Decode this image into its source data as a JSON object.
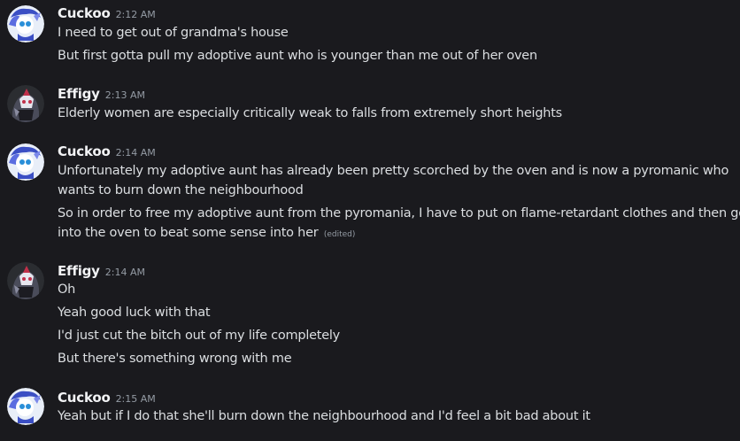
{
  "groups": [
    {
      "username": "Cuckoo",
      "time": "2:12 AM",
      "messages": [
        "I need to get out of grandma's house",
        "But first gotta pull my adoptive aunt who is younger than me out of her oven"
      ]
    },
    {
      "username": "Effigy",
      "time": "2:13 AM",
      "messages": [
        "Elderly women are especially critically weak to falls from extremely short heights"
      ]
    },
    {
      "username": "Cuckoo",
      "time": "2:14 AM",
      "messages": [
        "Unfortunately my adoptive aunt has already been pretty scorched by the oven and is now a pyromanic who",
        "wants to burn down the neighbourhood",
        "So in order to free my adoptive aunt from the pyromania, I have to put on flame-retardant clothes and then go",
        "into the oven to beat some sense into her"
      ],
      "edited_label": "(edited)"
    },
    {
      "username": "Effigy",
      "time": "2:14 AM",
      "messages": [
        "Oh",
        "Yeah good luck with that",
        "I'd just cut the bitch out of my life completely",
        "But there's something wrong with me"
      ]
    },
    {
      "username": "Cuckoo",
      "time": "2:15 AM",
      "messages": [
        "Yeah but if I do that she'll burn down the neighbourhood and I'd feel a bit bad about it"
      ]
    }
  ],
  "colors": {
    "background": "#1a1a1e",
    "text": "#dbdee1",
    "username": "#f2f3f5",
    "timestamp": "#949ba4"
  },
  "avatars": {
    "cuckoo": "cuckoo-avatar-icon",
    "effigy": "effigy-avatar-icon"
  }
}
